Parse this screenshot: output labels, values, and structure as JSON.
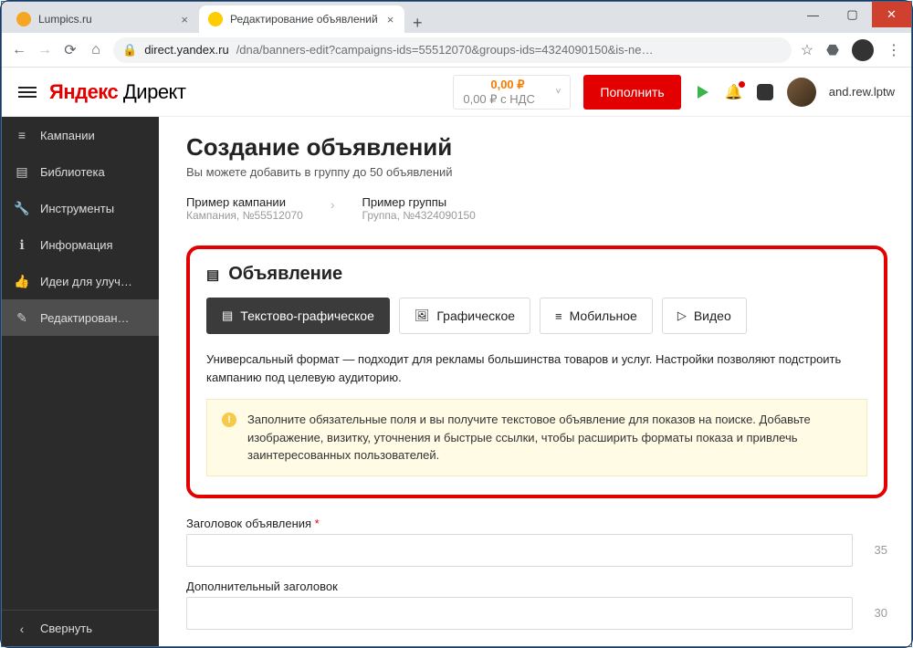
{
  "browser": {
    "tabs": [
      {
        "title": "Lumpics.ru",
        "favicon_color": "#f5a623",
        "active": false
      },
      {
        "title": "Редактирование объявлений",
        "favicon_color": "#ffcc00",
        "active": true
      }
    ],
    "window_buttons": {
      "min": "—",
      "max": "▢",
      "close": "✕"
    },
    "nav": {
      "back": "←",
      "fwd": "→",
      "reload": "⟳",
      "home": "⌂"
    },
    "url_host": "direct.yandex.ru",
    "url_path": "/dna/banners-edit?campaigns-ids=55512070&groups-ids=4324090150&is-ne…",
    "star": "☆",
    "ext_badge": "⬣",
    "menu": "⋮",
    "newtab": "+"
  },
  "header": {
    "logo_yandex": "Яндекс",
    "logo_direct": "Директ",
    "balance_main": "0,00 ₽",
    "balance_sub": "0,00 ₽ с НДС",
    "chevron": "˅",
    "topup": "Пополнить",
    "username": "and.rew.lptw"
  },
  "sidebar": {
    "items": [
      {
        "icon": "≡",
        "label": "Кампании"
      },
      {
        "icon": "▤",
        "label": "Библиотека"
      },
      {
        "icon": "🔧",
        "label": "Инструменты"
      },
      {
        "icon": "ℹ",
        "label": "Информация"
      },
      {
        "icon": "👍",
        "label": "Идеи для улуч…"
      },
      {
        "icon": "✎",
        "label": "Редактирован…"
      }
    ],
    "collapse_icon": "‹",
    "collapse": "Свернуть"
  },
  "main": {
    "title": "Создание объявлений",
    "subtitle": "Вы можете добавить в группу до 50 объявлений",
    "crumb1_name": "Пример кампании",
    "crumb1_meta": "Кампания, №55512070",
    "crumb_sep": "›",
    "crumb2_name": "Пример группы",
    "crumb2_meta": "Группа, №4324090150",
    "section_icon": "▤",
    "section_title": "Объявление",
    "types": [
      {
        "icon": "▤",
        "label": "Текстово-графическое",
        "active": true
      },
      {
        "icon": "🖼",
        "label": "Графическое",
        "active": false
      },
      {
        "icon": "≡",
        "label": "Мобильное",
        "active": false
      },
      {
        "icon": "▷",
        "label": "Видео",
        "active": false
      }
    ],
    "description": "Универсальный формат — подходит для рекламы большинства товаров и услуг. Настройки позволяют подстроить кампанию под целевую аудиторию.",
    "banner_icon": "!",
    "banner_text": "Заполните обязательные поля и вы получите текстовое объявление для показов на поиске. Добавьте изображение, визитку, уточнения и быстрые ссылки, чтобы расширить форматы показа и привлечь заинтересованных пользователей.",
    "field1_label": "Заголовок объявления",
    "field1_required": "*",
    "field1_counter": "35",
    "field2_label": "Дополнительный заголовок",
    "field2_counter": "30"
  }
}
